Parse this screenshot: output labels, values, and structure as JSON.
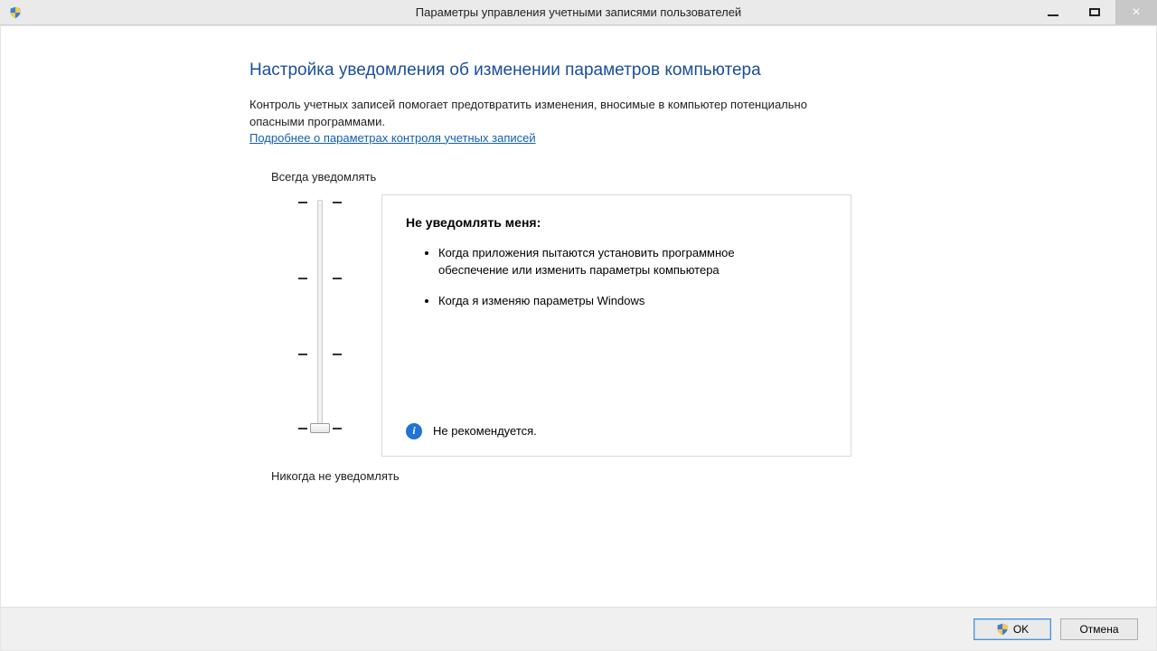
{
  "window": {
    "title": "Параметры управления учетными записями пользователей"
  },
  "heading": "Настройка уведомления об изменении параметров компьютера",
  "description": "Контроль учетных записей помогает предотвратить изменения, вносимые в компьютер потенциально опасными программами.",
  "learn_more": "Подробнее о параметрах контроля учетных записей",
  "slider": {
    "top_label": "Всегда уведомлять",
    "bottom_label": "Никогда не уведомлять",
    "levels": 4,
    "selected_index": 3
  },
  "info_box": {
    "heading": "Не уведомлять меня:",
    "bullets": [
      "Когда приложения пытаются установить программное обеспечение или изменить параметры компьютера",
      "Когда я изменяю параметры Windows"
    ],
    "recommendation": "Не рекомендуется."
  },
  "buttons": {
    "ok": "OK",
    "cancel": "Отмена"
  }
}
